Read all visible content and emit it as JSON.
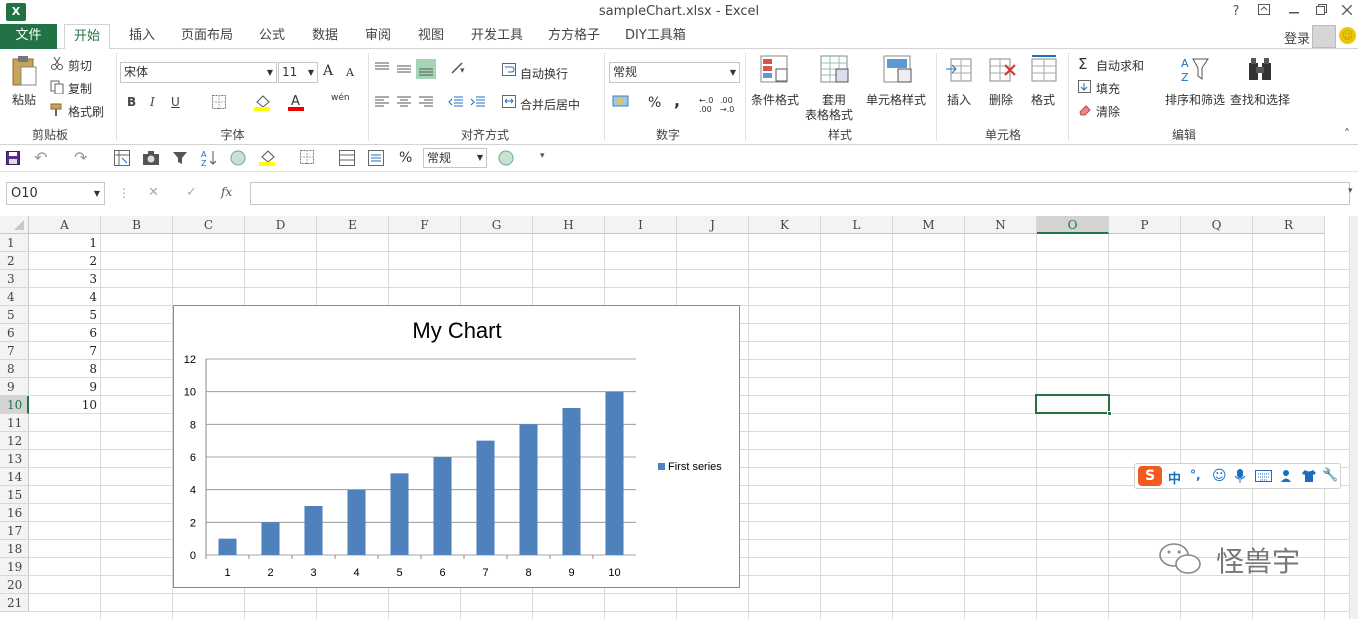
{
  "window": {
    "title": "sampleChart.xlsx - Excel",
    "help": "?",
    "login": "登录"
  },
  "tabs": [
    {
      "label": "文件"
    },
    {
      "label": "开始"
    },
    {
      "label": "插入"
    },
    {
      "label": "页面布局"
    },
    {
      "label": "公式"
    },
    {
      "label": "数据"
    },
    {
      "label": "审阅"
    },
    {
      "label": "视图"
    },
    {
      "label": "开发工具"
    },
    {
      "label": "方方格子"
    },
    {
      "label": "DIY工具箱"
    }
  ],
  "ribbon": {
    "clipboard": {
      "paste": "粘贴",
      "cut": "剪切",
      "copy": "复制",
      "format_painter": "格式刷",
      "group": "剪贴板"
    },
    "font": {
      "name": "宋体",
      "size": "11",
      "bold": "B",
      "italic": "I",
      "underline": "U",
      "group": "字体",
      "grow": "A",
      "shrink": "A",
      "phonetic": "wén"
    },
    "alignment": {
      "wrap": "自动换行",
      "merge": "合并后居中",
      "group": "对齐方式"
    },
    "number": {
      "format": "常规",
      "percent": "%",
      "comma": ",",
      "inc": "←.0 .00",
      "dec": ".00 →.0",
      "group": "数字"
    },
    "styles": {
      "conditional": "条件格式",
      "table_line1": "套用",
      "table_line2": "表格格式",
      "cell_styles": "单元格样式",
      "group": "样式"
    },
    "cells": {
      "insert": "插入",
      "delete": "删除",
      "format": "格式",
      "group": "单元格"
    },
    "editing": {
      "autosum": "自动求和",
      "fill": "填充",
      "clear": "清除",
      "sort": "排序和筛选",
      "find": "查找和选择",
      "group": "编辑"
    }
  },
  "qat": {
    "format_value": "常规",
    "percent": "%"
  },
  "formula_bar": {
    "name_box": "O10",
    "fx": "fx",
    "value": ""
  },
  "sheet": {
    "columns": [
      "A",
      "B",
      "C",
      "D",
      "E",
      "F",
      "G",
      "H",
      "I",
      "J",
      "K",
      "L",
      "M",
      "N",
      "O",
      "P",
      "Q",
      "R"
    ],
    "rows": [
      "1",
      "2",
      "3",
      "4",
      "5",
      "6",
      "7",
      "8",
      "9",
      "10",
      "11",
      "12",
      "13",
      "14",
      "15",
      "16",
      "17",
      "18",
      "19",
      "20",
      "21"
    ],
    "col_a_values": [
      "1",
      "2",
      "3",
      "4",
      "5",
      "6",
      "7",
      "8",
      "9",
      "10"
    ],
    "selected_cell": "O10",
    "colors": {
      "accent": "#217346",
      "selection": "#217346"
    }
  },
  "chart_data": {
    "type": "bar",
    "title": "My Chart",
    "categories": [
      "1",
      "2",
      "3",
      "4",
      "5",
      "6",
      "7",
      "8",
      "9",
      "10"
    ],
    "series": [
      {
        "name": "First series",
        "values": [
          1,
          2,
          3,
          4,
          5,
          6,
          7,
          8,
          9,
          10
        ],
        "color": "#4f81bd"
      }
    ],
    "ylim": [
      0,
      12
    ],
    "yticks": [
      0,
      2,
      4,
      6,
      8,
      10,
      12
    ],
    "grid": true,
    "legend": "right"
  },
  "ime_toolbar": {
    "mode": "中",
    "punct": "°,"
  },
  "watermark": {
    "text": "怪兽宇"
  }
}
